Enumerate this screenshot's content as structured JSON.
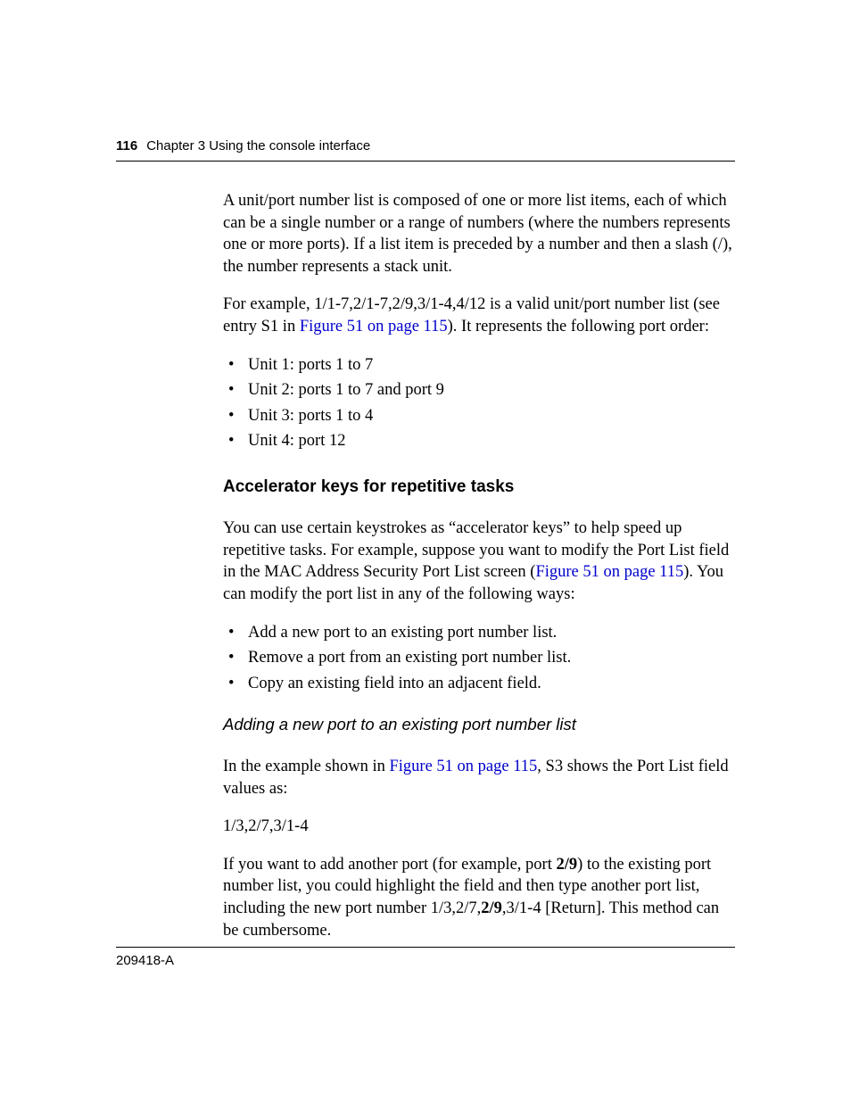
{
  "header": {
    "page_number": "116",
    "chapter_text": "Chapter 3  Using the console interface"
  },
  "body": {
    "p1": "A unit/port number list is composed of one or more list items, each of which can be a single number or a range of numbers (where the numbers represents one or more ports). If a list item is preceded by a number and then a slash (/), the number represents a stack unit.",
    "p2_pre": "For example, 1/1-7,2/1-7,2/9,3/1-4,4/12 is a valid unit/port number list (see entry S1 in ",
    "p2_link": "Figure 51 on page 115",
    "p2_post": "). It represents the following port order:",
    "list1": [
      "Unit 1: ports 1 to 7",
      "Unit 2: ports 1 to 7 and port 9",
      "Unit 3: ports 1 to 4",
      "Unit 4: port 12"
    ],
    "h2": "Accelerator keys for repetitive tasks",
    "p3_pre": "You can use certain keystrokes as “accelerator keys” to help speed up repetitive tasks. For example, suppose you want to modify the Port List field in the MAC Address Security Port List screen (",
    "p3_link": "Figure 51 on page 115",
    "p3_post": "). You can modify the port list in any of the following ways:",
    "list2": [
      "Add a new port to an existing port number list.",
      "Remove a port from an existing port number list.",
      "Copy an existing field into an adjacent field."
    ],
    "h3": "Adding a new port to an existing port number list",
    "p4_pre": "In the example shown in ",
    "p4_link": "Figure 51 on page 115",
    "p4_post": ", S3 shows the Port List field values as:",
    "p5": "1/3,2/7,3/1-4",
    "p6_pre": "If you want to add another port (for example, port ",
    "p6_b1": "2/9",
    "p6_mid1": ") to the existing port number list, you could highlight the field and then type another port list, including the new port number 1/3,2/7,",
    "p6_b2": "2/9",
    "p6_mid2": ",3/1-4 [Return]. This method can be cumbersome."
  },
  "footer": {
    "doc_number": "209418-A"
  }
}
